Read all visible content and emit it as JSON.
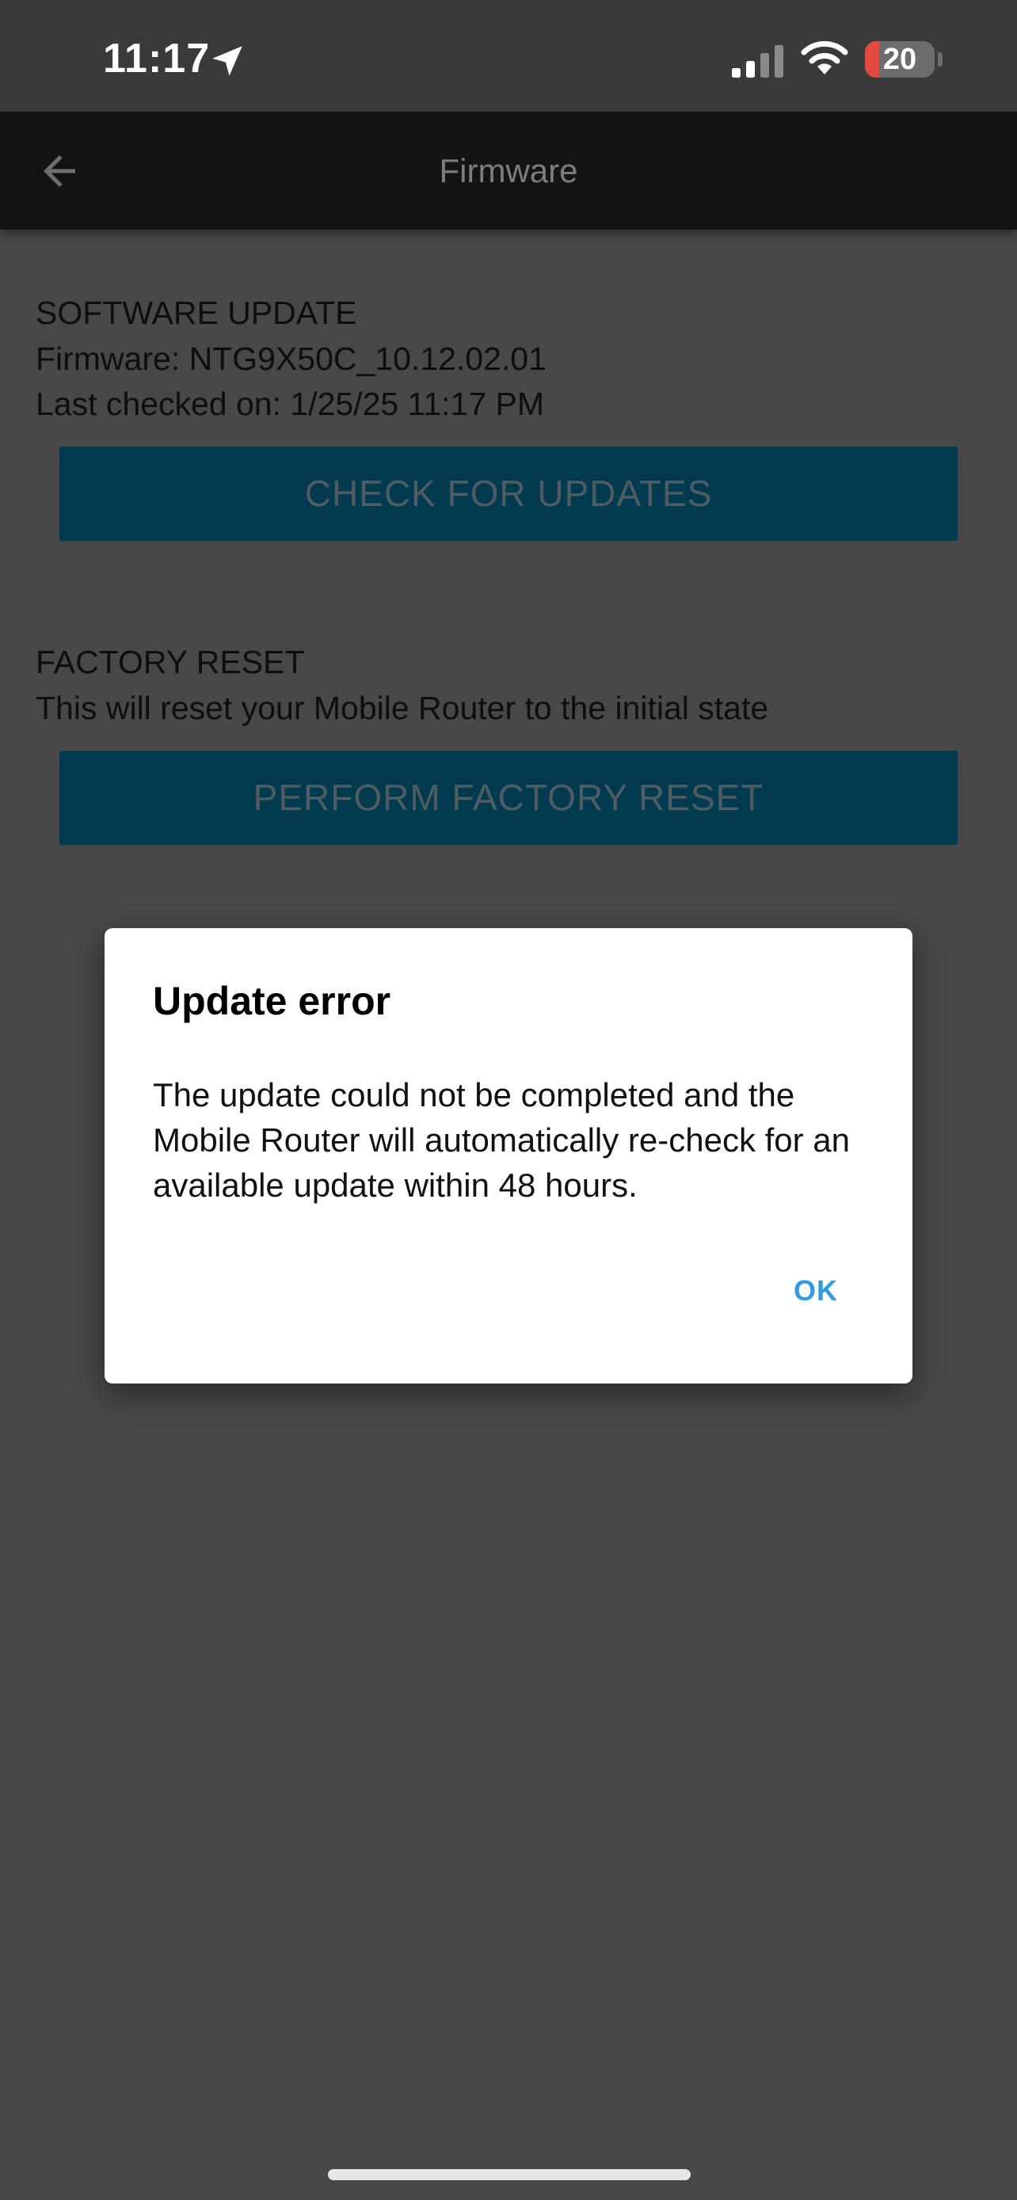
{
  "status_bar": {
    "time": "11:17",
    "battery_percent": "20",
    "battery_level": 0.2,
    "icons": [
      "location-arrow-icon",
      "cellular-signal-icon",
      "wifi-icon",
      "battery-icon"
    ]
  },
  "app_bar": {
    "back_icon": "arrow-left-icon",
    "title": "Firmware"
  },
  "software_update": {
    "heading": "SOFTWARE UPDATE",
    "firmware_line": "Firmware: NTG9X50C_10.12.02.01",
    "last_checked_line": "Last checked on: 1/25/25 11:17 PM",
    "button_label": "CHECK FOR UPDATES"
  },
  "factory_reset": {
    "heading": "FACTORY RESET",
    "description": "This will reset your Mobile Router to the initial state",
    "button_label": "PERFORM FACTORY RESET"
  },
  "dialog": {
    "title": "Update error",
    "message": "The update could not be completed and the Mobile Router will automatically re-check for an available update within 48 hours.",
    "ok_label": "OK"
  },
  "colors": {
    "background": "#484848",
    "app_bar": "#141414",
    "button": "#023a50",
    "dialog_accent": "#2e9be2",
    "battery_low": "#e5483f"
  }
}
